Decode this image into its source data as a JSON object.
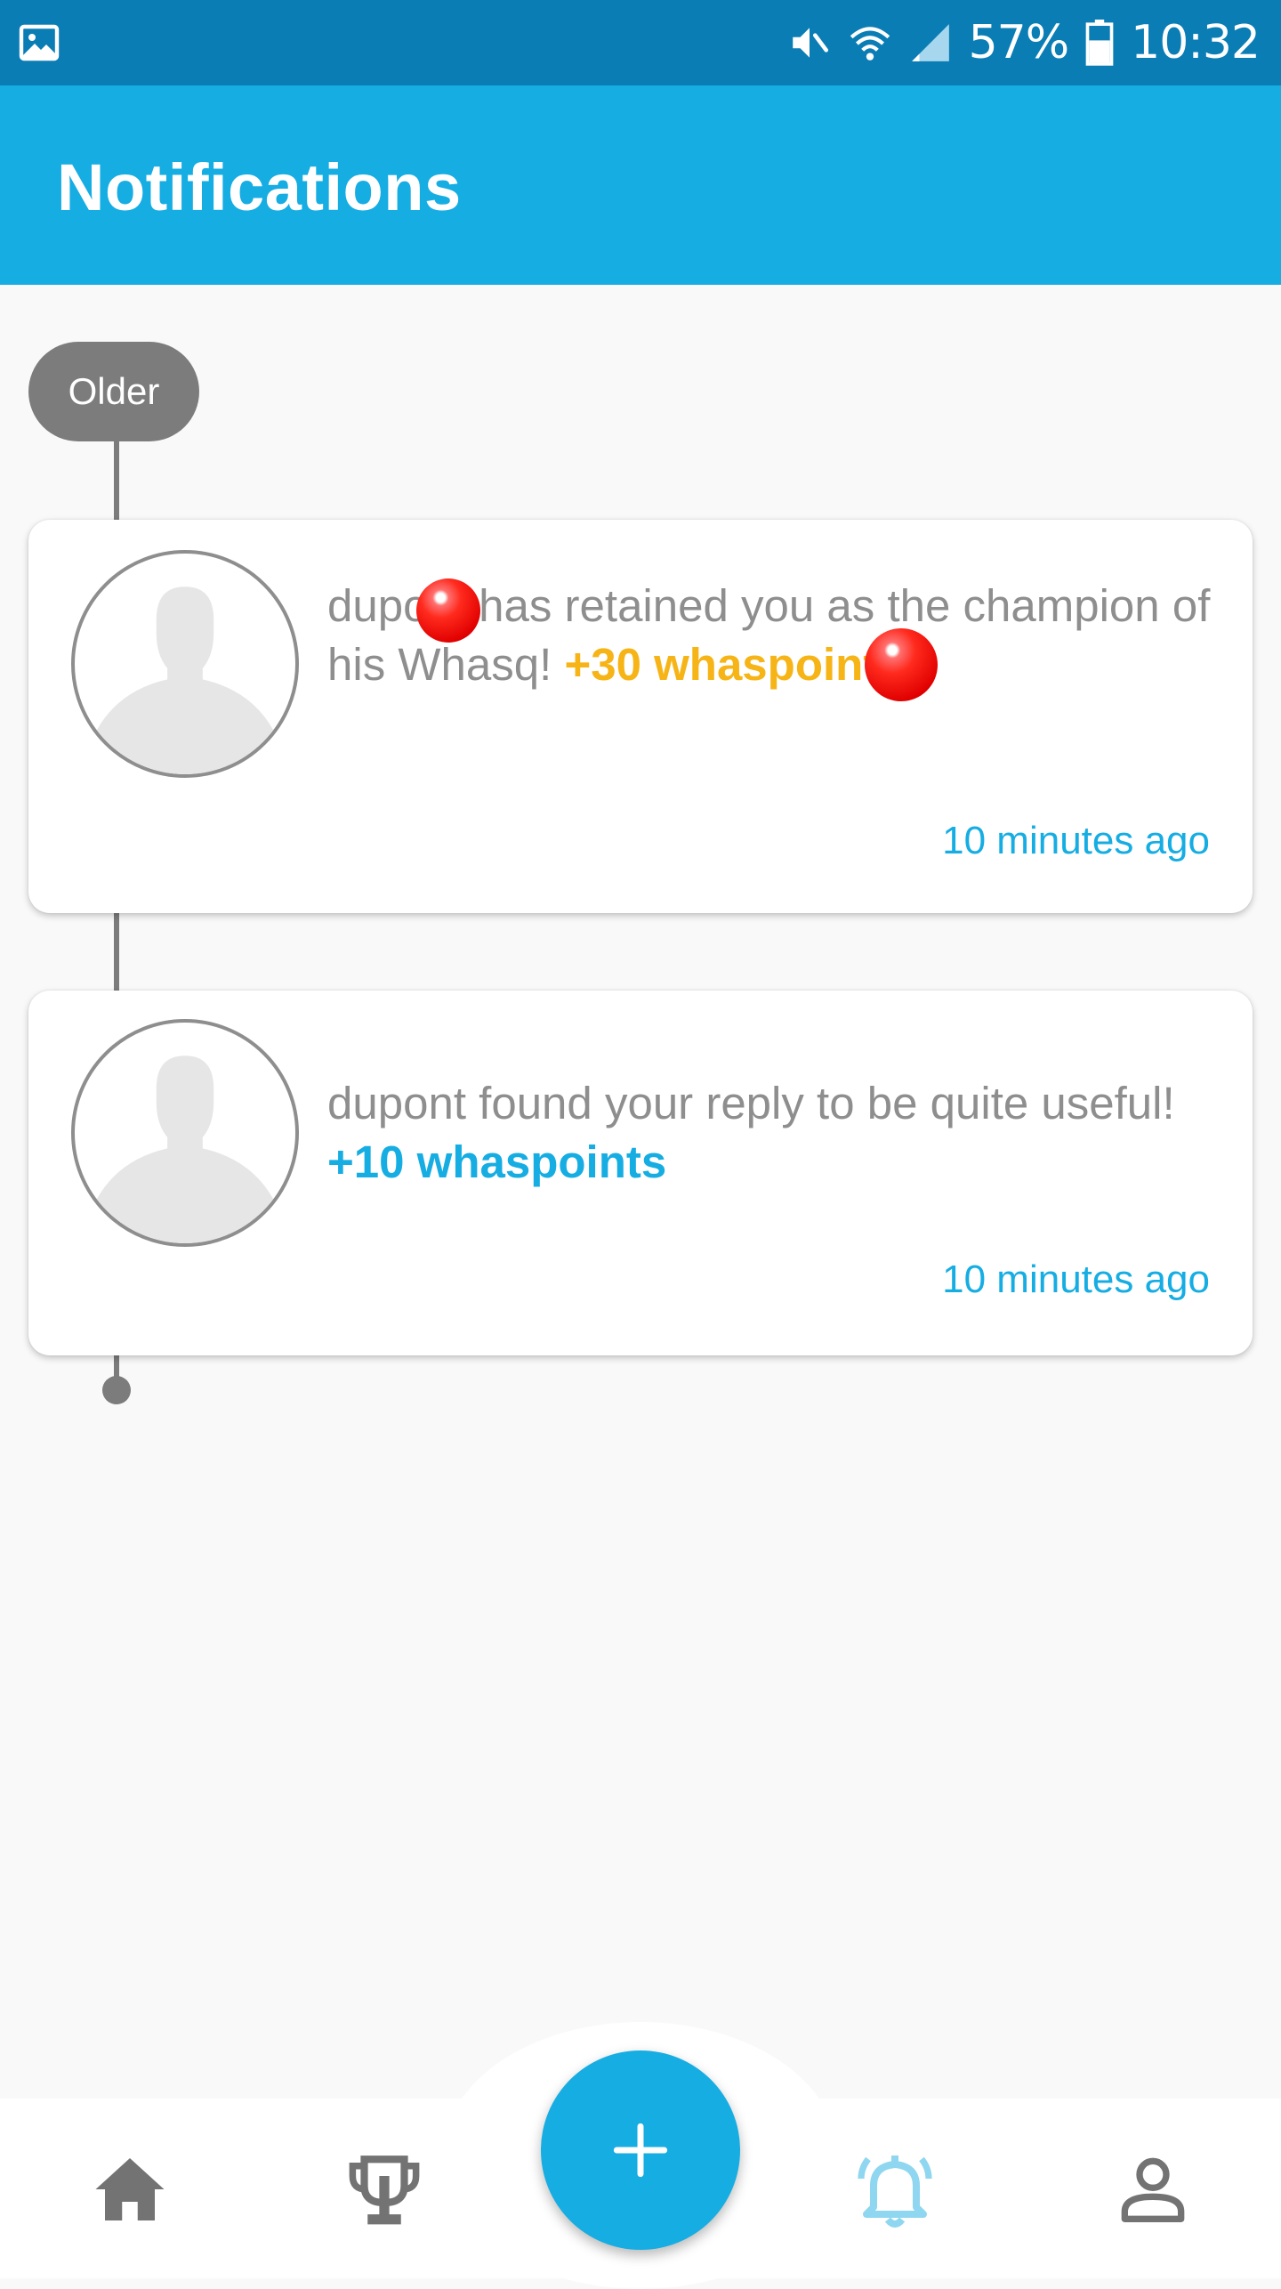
{
  "status_bar": {
    "battery": "57%",
    "time": "10:32",
    "icons": [
      "gallery-icon",
      "mute-icon",
      "wifi-icon",
      "signal-icon",
      "battery-icon"
    ]
  },
  "header": {
    "title": "Notifications"
  },
  "timeline": {
    "section_label": "Older"
  },
  "notifications": [
    {
      "text": "dupont has retained you as the champion of his Whasq!",
      "points": "+30 whaspoints",
      "time": "10 minutes ago"
    },
    {
      "text": "dupont found your reply to be quite useful!",
      "points": "+10 whaspoints",
      "time": "10 minutes ago"
    }
  ],
  "bottom_nav": {
    "items": [
      "home-icon",
      "trophy-icon",
      "add-icon",
      "bell-icon",
      "profile-icon"
    ],
    "active": "bell-icon"
  },
  "colors": {
    "status_bar": "#0a7db5",
    "app_bar": "#16ade3",
    "accent": "#16ade3",
    "points_gold": "#f6b416",
    "text_grey": "#8e8e8e",
    "timeline_grey": "#7c7c7c"
  }
}
